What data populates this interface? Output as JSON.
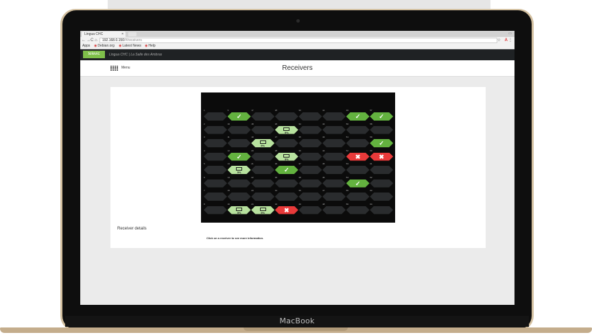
{
  "device": {
    "chin_label": "MacBook"
  },
  "browser": {
    "tab_title": "Lingua CHC",
    "tab_close": "×",
    "window_controls": "▭",
    "nav_back": "←",
    "nav_forward": "→",
    "nav_reload": "C",
    "nav_home": "⌂",
    "url_host": "192.168.0.150",
    "url_path": "/#/receivers",
    "bookmarks": [
      {
        "label": "Apps"
      },
      {
        "label": "Debian.org"
      },
      {
        "label": "Latest News"
      },
      {
        "label": "Help"
      }
    ],
    "star": "☆",
    "extension": "A",
    "menu_dots": "⋮"
  },
  "app": {
    "logo_text": "televic",
    "breadcrumb": "Lingua CHC | La Salle des Ambras",
    "menu_label": "Menu",
    "page_title": "Receivers",
    "details_title": "Receiver details",
    "details_hint": "Click on a receiver to see more information."
  },
  "receivers": {
    "columns": [
      [
        "1",
        "2",
        "3",
        "4",
        "5",
        "6",
        "7",
        "8",
        "9"
      ],
      [
        "9",
        "10",
        "11",
        "12",
        "13",
        "14",
        "15",
        "16"
      ],
      [
        "17",
        "18",
        "19",
        "20",
        "21",
        "22",
        "23",
        "24"
      ],
      [
        "25",
        "26",
        "27",
        "28",
        "29",
        "30",
        "31",
        "32"
      ],
      [
        "33",
        "34",
        "35",
        "36",
        "37",
        "38",
        "39",
        "40"
      ],
      [
        "41",
        "42",
        "43",
        "44",
        "45",
        "46",
        "47",
        "48"
      ],
      [
        "49",
        "50",
        "51",
        "52",
        "53",
        "54",
        "55",
        "56"
      ],
      [
        "57",
        "58",
        "59",
        "60",
        "61",
        "62",
        "63",
        "64"
      ]
    ],
    "statuses": [
      [
        "idle",
        "idle",
        "idle",
        "idle",
        "idle",
        "idle",
        "idle",
        "idle",
        "idle"
      ],
      [
        "ok",
        "idle",
        "idle",
        "ok",
        "bat",
        "idle",
        "idle",
        "bat"
      ],
      [
        "idle",
        "idle",
        "bat",
        "idle",
        "idle",
        "idle",
        "idle",
        "bat"
      ],
      [
        "idle",
        "bat",
        "idle",
        "bat",
        "ok",
        "idle",
        "idle",
        "err"
      ],
      [
        "idle",
        "idle",
        "idle",
        "idle",
        "idle",
        "idle",
        "idle",
        "idle"
      ],
      [
        "idle",
        "idle",
        "idle",
        "idle",
        "idle",
        "idle",
        "idle",
        "idle"
      ],
      [
        "ok",
        "idle",
        "idle",
        "err",
        "idle",
        "ok",
        "idle",
        "idle"
      ],
      [
        "ok",
        "idle",
        "ok",
        "err",
        "idle",
        "idle",
        "idle",
        "idle"
      ]
    ],
    "battery_label": "5%",
    "ok_symbol": "✓",
    "err_symbol": "✖"
  },
  "colors": {
    "ok": "#63b23f",
    "battery": "#b7e19e",
    "error": "#e83a3a",
    "idle": "#2a2c2e",
    "brand": "#7fc04a"
  }
}
